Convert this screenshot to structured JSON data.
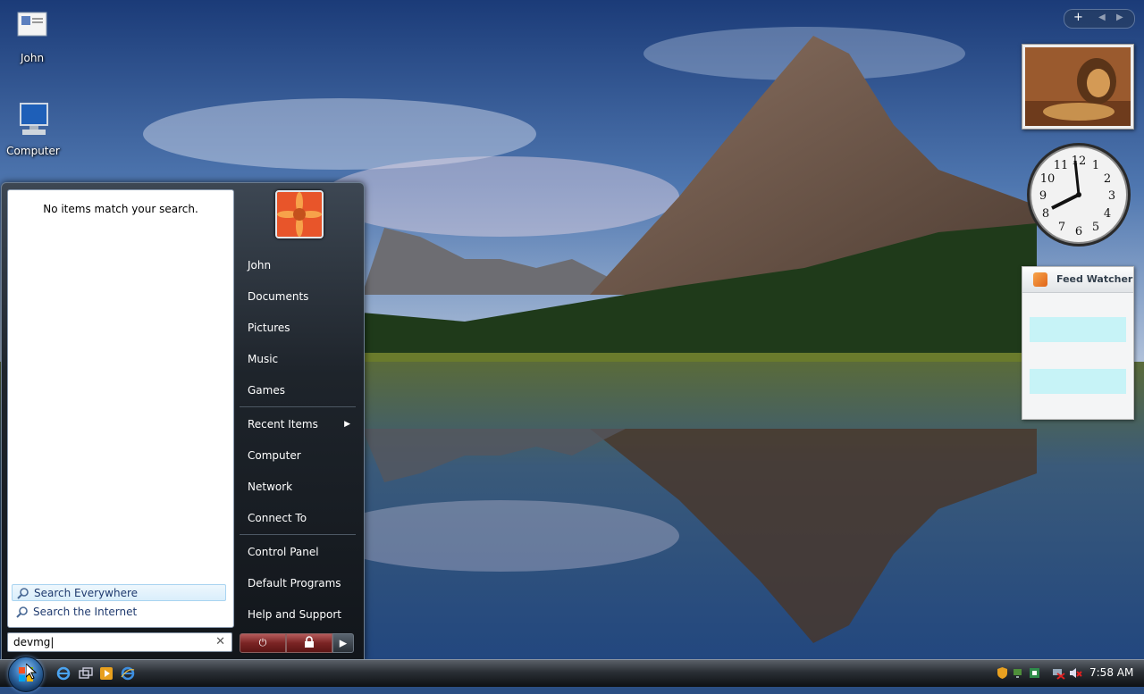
{
  "desktop": {
    "icons": [
      {
        "label": "John"
      },
      {
        "label": "Computer"
      }
    ]
  },
  "start_menu": {
    "no_results_text": "No items match your search.",
    "search_links": [
      {
        "label": "Search Everywhere",
        "icon": "magnifier-icon",
        "selected": true
      },
      {
        "label": "Search the Internet",
        "icon": "magnifier-icon",
        "selected": false
      }
    ],
    "search_query": "devmg",
    "right_pane": {
      "items": [
        {
          "label": "John"
        },
        {
          "label": "Documents"
        },
        {
          "label": "Pictures"
        },
        {
          "label": "Music"
        },
        {
          "label": "Games"
        },
        {
          "label": "Recent Items",
          "has_submenu": true
        },
        {
          "label": "Computer"
        },
        {
          "label": "Network"
        },
        {
          "label": "Connect To"
        },
        {
          "label": "Control Panel"
        },
        {
          "label": "Default Programs"
        },
        {
          "label": "Help and Support"
        }
      ]
    },
    "power_buttons": [
      "power-icon",
      "lock-icon",
      "arrow-right-icon"
    ]
  },
  "sidebar": {
    "controls": [
      "+",
      "◀",
      "▶"
    ],
    "clock_numbers": [
      "12",
      "1",
      "2",
      "3",
      "4",
      "5",
      "6",
      "7",
      "8",
      "9",
      "10",
      "11"
    ],
    "feed_watcher": {
      "title": "Feed Watcher",
      "icon": "rss-icon"
    }
  },
  "taskbar": {
    "time": "7:58 AM",
    "quick_launch": [
      "ie-icon",
      "switch-windows-icon",
      "media-player-icon",
      "internet-explorer-icon"
    ],
    "tray_icons": [
      "shield-icon",
      "network-icon",
      "update-icon",
      "network-disconnected-icon",
      "volume-muted-icon"
    ]
  },
  "colors": {
    "accent": "#3a78b8",
    "feed_row": "#c7f3f7",
    "power_red": "#7a2424"
  }
}
